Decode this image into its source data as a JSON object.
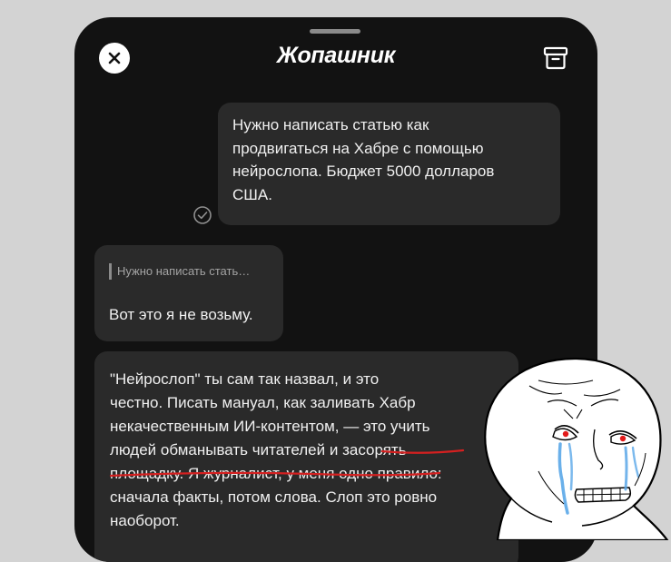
{
  "header": {
    "title": "Жопашник",
    "close_icon": "close-icon",
    "archive_icon": "archive-icon"
  },
  "messages": [
    {
      "direction": "outgoing",
      "lines": [
        "Нужно написать статью как",
        "продвигаться на Хабре с помощью",
        "нейрослопа. Бюджет 5000 долларов",
        "США."
      ],
      "status_icon": "read-check-icon"
    },
    {
      "direction": "incoming",
      "reply_quote": "Нужно написать стать…",
      "text": "Вот это я не возьму."
    },
    {
      "direction": "incoming",
      "lines": [
        "\"Нейрослоп\" ты сам так назвал, и это",
        "честно. Писать мануал, как заливать Хабр",
        "некачественным ИИ-контентом, — это учить",
        "людей обманывать читателей и засорять",
        "площадку. Я журналист, у меня одно правило:",
        "сначала факты, потом слова. Слоп это ровно",
        "наоборот."
      ],
      "highlight_color": "#d42020"
    }
  ],
  "overlay": {
    "icon": "crying-wojak-meme"
  },
  "colors": {
    "background": "#d3d3d3",
    "phone": "#121212",
    "bubble": "#2a2a2a",
    "text": "#f0f0f0",
    "muted": "#a3a3a3"
  }
}
